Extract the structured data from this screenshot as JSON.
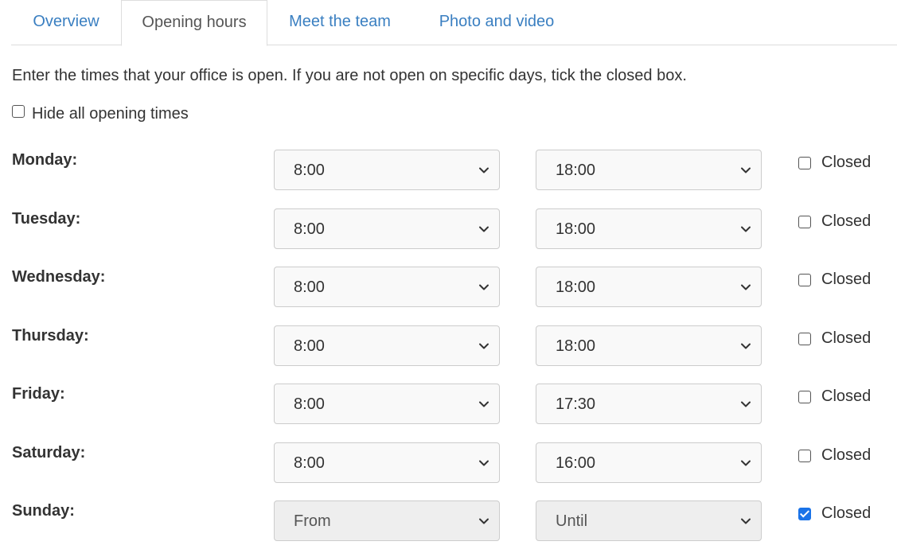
{
  "tabs": [
    {
      "label": "Overview",
      "active": false
    },
    {
      "label": "Opening hours",
      "active": true
    },
    {
      "label": "Meet the team",
      "active": false
    },
    {
      "label": "Photo and video",
      "active": false
    }
  ],
  "intro": "Enter the times that your office is open. If you are not open on specific days, tick the closed box.",
  "hide_all": {
    "label": "Hide all opening times",
    "checked": false
  },
  "closed_label": "Closed",
  "days": [
    {
      "label": "Monday:",
      "from": "8:00",
      "until": "18:00",
      "closed": false
    },
    {
      "label": "Tuesday:",
      "from": "8:00",
      "until": "18:00",
      "closed": false
    },
    {
      "label": "Wednesday:",
      "from": "8:00",
      "until": "18:00",
      "closed": false
    },
    {
      "label": "Thursday:",
      "from": "8:00",
      "until": "18:00",
      "closed": false
    },
    {
      "label": "Friday:",
      "from": "8:00",
      "until": "17:30",
      "closed": false
    },
    {
      "label": "Saturday:",
      "from": "8:00",
      "until": "16:00",
      "closed": false
    },
    {
      "label": "Sunday:",
      "from": "From",
      "until": "Until",
      "closed": true
    }
  ],
  "colors": {
    "link": "#3a7fc1",
    "checkbox_checked": "#1a73e8"
  }
}
